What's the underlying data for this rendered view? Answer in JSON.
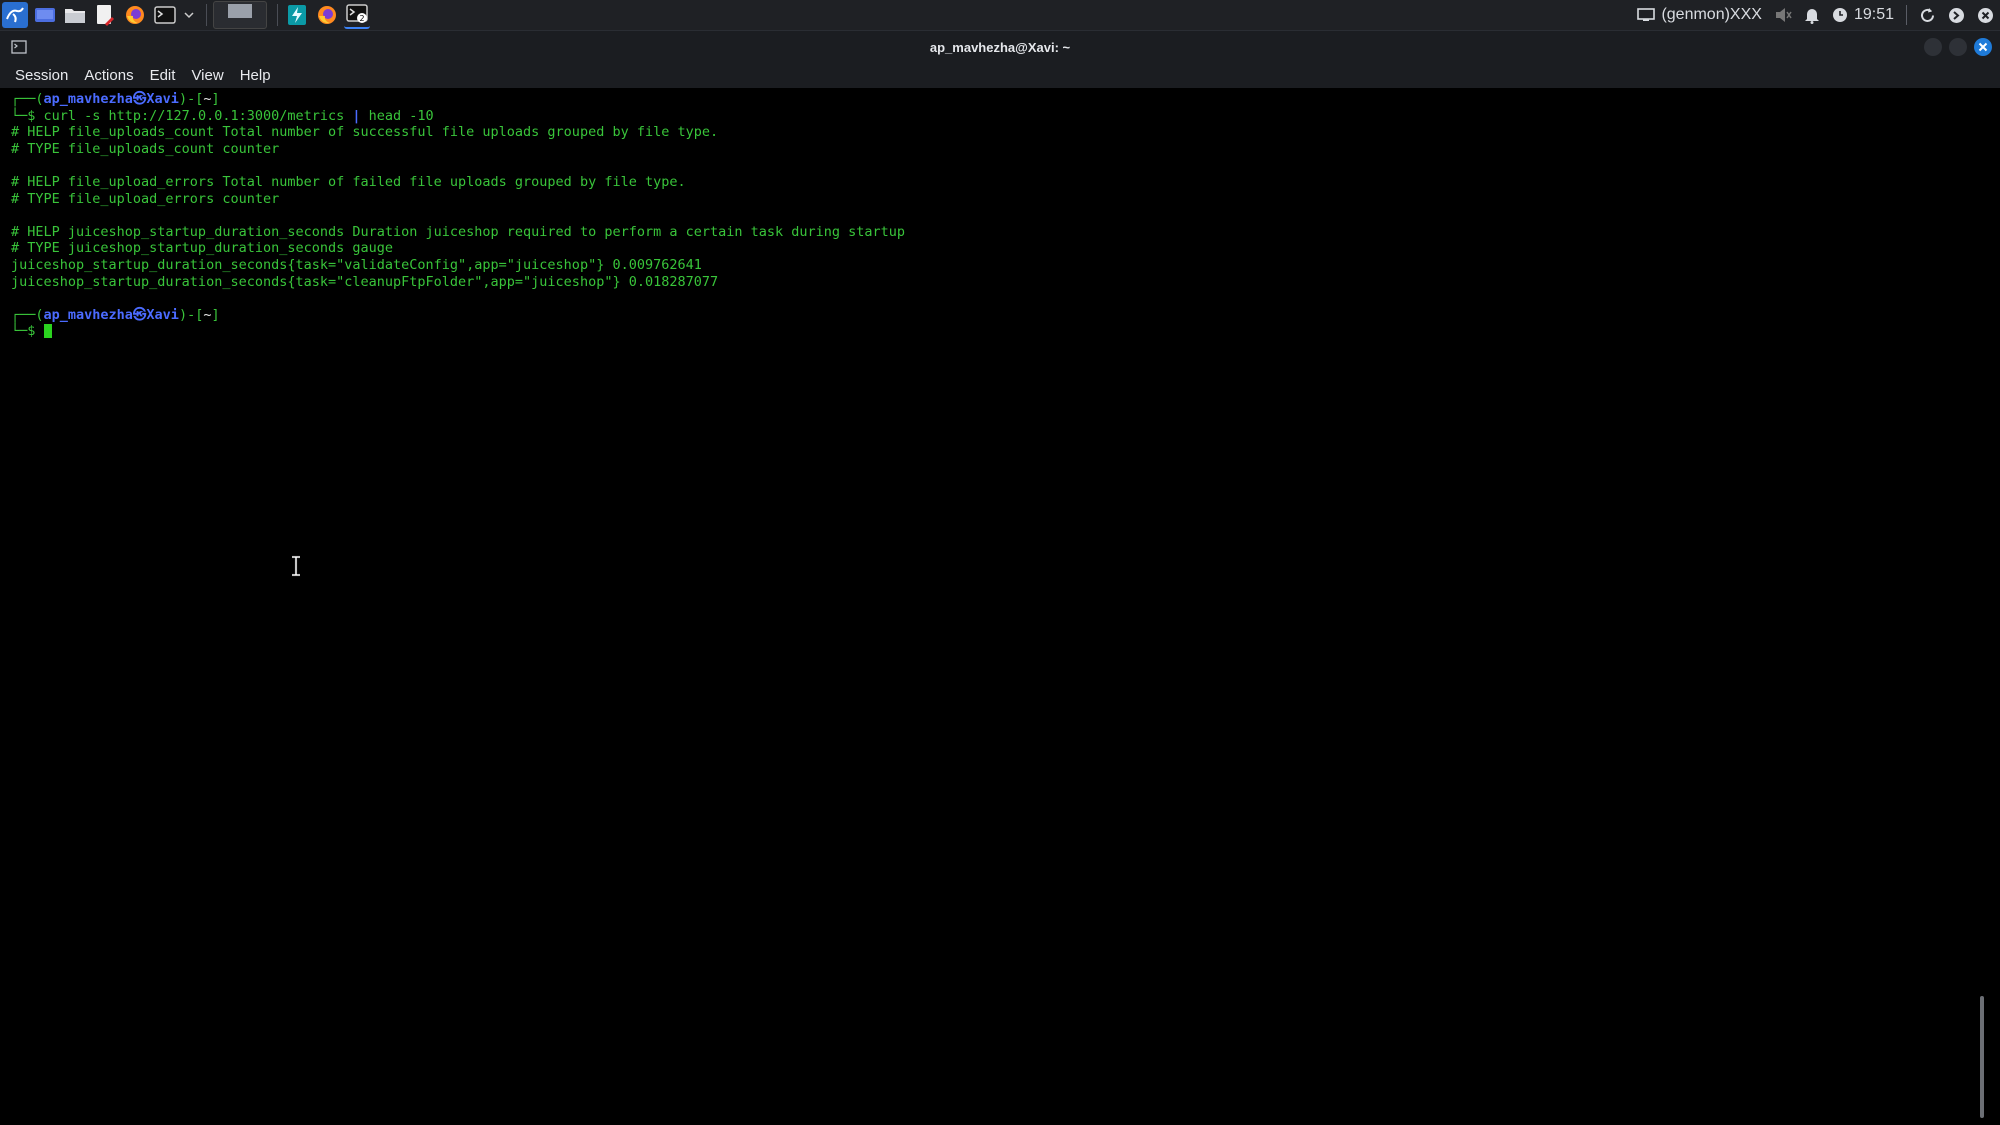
{
  "taskbar": {
    "launchers": [
      "kali-menu-icon",
      "desktop-icon",
      "file-manager-icon",
      "text-editor-icon",
      "firefox-icon",
      "terminal-icon",
      "dropdown-arrow-icon"
    ],
    "genmon": "(genmon)XXX",
    "clock": "19:51"
  },
  "window": {
    "title": "ap_mavhezha@Xavi: ~"
  },
  "menu": {
    "session": "Session",
    "actions": "Actions",
    "edit": "Edit",
    "view": "View",
    "help": "Help"
  },
  "terminal": {
    "prompt1": {
      "frame_open": "┌──(",
      "user_host": "ap_mavhezha㉿Xavi",
      "frame_close": ")-[",
      "cwd": "~",
      "bracket": "]"
    },
    "cmd_prefix": "└─$ ",
    "command_main": "curl -s http://127.0.0.1:3000/metrics ",
    "command_pipe": "| ",
    "command_tail": "head -10",
    "output": [
      "# HELP file_uploads_count Total number of successful file uploads grouped by file type.",
      "# TYPE file_uploads_count counter",
      "",
      "# HELP file_upload_errors Total number of failed file uploads grouped by file type.",
      "# TYPE file_upload_errors counter",
      "",
      "# HELP juiceshop_startup_duration_seconds Duration juiceshop required to perform a certain task during startup",
      "# TYPE juiceshop_startup_duration_seconds gauge",
      "juiceshop_startup_duration_seconds{task=\"validateConfig\",app=\"juiceshop\"} 0.009762641",
      "juiceshop_startup_duration_seconds{task=\"cleanupFtpFolder\",app=\"juiceshop\"} 0.018287077"
    ],
    "prompt2": {
      "frame_open": "┌──(",
      "user_host": "ap_mavhezha㉿Xavi",
      "frame_close": ")-[",
      "cwd": "~",
      "bracket": "]"
    },
    "prompt2_symbol": "└─$ "
  },
  "colors": {
    "prompt_green": "#39c43a",
    "user_blue": "#4b6bff",
    "close_button": "#1f7bd9"
  }
}
